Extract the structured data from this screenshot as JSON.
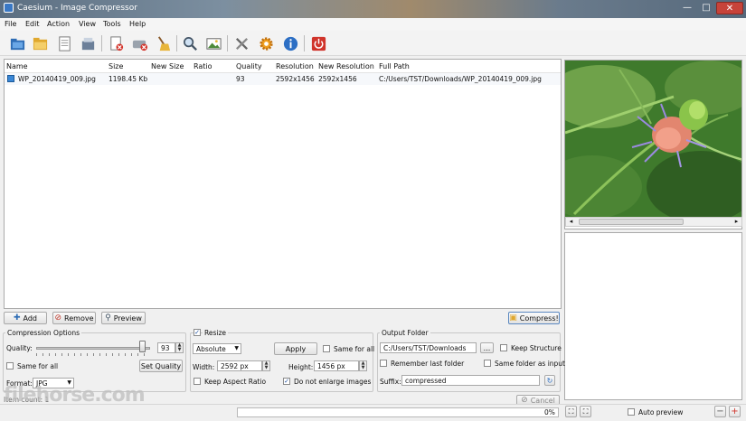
{
  "window": {
    "title": "Caesium - Image Compressor",
    "min": "—",
    "max": "□",
    "close": "✕"
  },
  "menu": [
    "File",
    "Edit",
    "Action",
    "View",
    "Tools",
    "Help"
  ],
  "toolbar_icons": [
    "add-picture-icon",
    "add-folder-icon",
    "save-list-icon",
    "open-list-icon",
    "remove-item-icon",
    "clear-list-icon",
    "clean-broom-icon",
    "search-icon",
    "preview-image-icon",
    "settings-tools-icon",
    "plugins-gear-icon",
    "info-icon",
    "power-icon"
  ],
  "list": {
    "columns": [
      "Name",
      "Size",
      "New Size",
      "Ratio",
      "Quality",
      "Resolution",
      "New Resolution",
      "Full Path"
    ],
    "rows": [
      {
        "name": "WP_20140419_009.jpg",
        "size": "1198.45 Kb",
        "new_size": "",
        "ratio": "",
        "quality": "93",
        "resolution": "2592x1456",
        "new_resolution": "2592x1456",
        "full_path": "C:/Users/TST/Downloads/WP_20140419_009.jpg"
      }
    ]
  },
  "buttons": {
    "add": "Add",
    "remove": "Remove",
    "preview": "Preview",
    "compress": "Compress!",
    "cancel": "Cancel"
  },
  "compression": {
    "title": "Compression Options",
    "quality_label": "Quality:",
    "quality_value": "93",
    "quality_fraction": 0.93,
    "same_for_all": "Same for all",
    "set_quality": "Set Quality",
    "format_label": "Format:",
    "format_value": "JPG"
  },
  "resize": {
    "label": "Resize",
    "checked": true,
    "mode": "Absolute",
    "apply": "Apply",
    "same_for_all": "Same for all",
    "width_label": "Width:",
    "width_value": "2592 px",
    "height_label": "Height:",
    "height_value": "1456 px",
    "keep_aspect": "Keep Aspect Ratio",
    "no_enlarge": "Do not enlarge images",
    "no_enlarge_checked": true
  },
  "output": {
    "title": "Output Folder",
    "path": "C:/Users/TST/Downloads",
    "browse": "...",
    "keep_structure": "Keep Structure",
    "remember_last": "Remember last folder",
    "same_folder": "Same folder as input",
    "suffix_label": "Suffix:",
    "suffix_value": "compressed"
  },
  "status": {
    "item_count": "Item count: 1",
    "progress_text": "0%",
    "progress": 0,
    "auto_preview": "Auto preview"
  },
  "watermark": "filehorse.com"
}
